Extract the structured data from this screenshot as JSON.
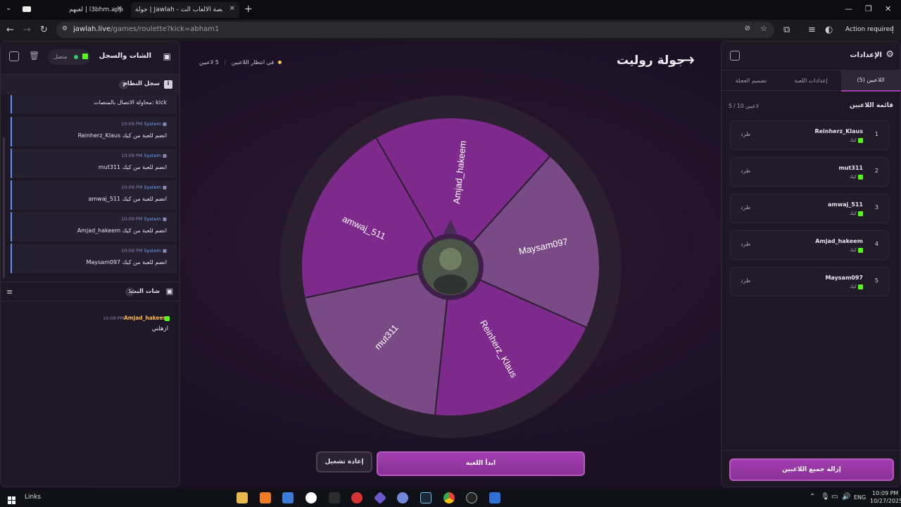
{
  "browser": {
    "tabs": [
      {
        "label": "لعبهم | l3bhm.app"
      },
      {
        "label": "جولة | Jawlah - منصة الألعاب الت..."
      }
    ],
    "url_host": "jawlah.live",
    "url_path": "/games/roulette?kick=abham1",
    "action_required": "Action required"
  },
  "left": {
    "title": "الشات والسجل",
    "status": "متصل",
    "system_log_title": "سجل النظام",
    "system_log_count": "7",
    "first_log_text": "محاولة الاتصال بالمنصات: kick",
    "logs": [
      {
        "time": "10:09 PM",
        "source": "System",
        "text": "Reinherz_Klaus انضم للعبة من كيك"
      },
      {
        "time": "10:09 PM",
        "source": "System",
        "text": "mut311 انضم للعبة من كيك"
      },
      {
        "time": "10:09 PM",
        "source": "System",
        "text": "amwaj_511 انضم للعبة من كيك"
      },
      {
        "time": "10:09 PM",
        "source": "System",
        "text": "Amjad_hakeem انضم للعبة من كيك"
      },
      {
        "time": "10:09 PM",
        "source": "System",
        "text": "Maysam097 انضم للعبة من كيك"
      }
    ],
    "live_chat_title": "شات البث",
    "live_chat_count": "1",
    "chat": [
      {
        "user": "Amjad_hakeem",
        "time": "10:09 PM",
        "text": "ازهلني"
      }
    ]
  },
  "center": {
    "title": "جولة روليت",
    "players_count": "5 لاعبين",
    "status": "في انتظار اللاعبين",
    "wheel_segments": [
      "Amjad_hakeem",
      "Maysam097",
      "Reinherz_Klaus",
      "mut311",
      "amwaj_511"
    ],
    "start_button": "ابدأ اللعبة",
    "restart_button": "إعادة تشغيل"
  },
  "right": {
    "title": "الإعدادات",
    "tabs": [
      "اللاعبين (5)",
      "إعدادات اللعبة",
      "تصميم العجلة"
    ],
    "list_title": "قائمة اللاعبين",
    "capacity": "5 / 10 لاعبين",
    "players": [
      {
        "num": "1",
        "name": "Reinherz_Klaus",
        "platform": "كيك",
        "kick": "طرد"
      },
      {
        "num": "2",
        "name": "mut311",
        "platform": "كيك",
        "kick": "طرد"
      },
      {
        "num": "3",
        "name": "amwaj_511",
        "platform": "كيك",
        "kick": "طرد"
      },
      {
        "num": "4",
        "name": "Amjad_hakeem",
        "platform": "كيك",
        "kick": "طرد"
      },
      {
        "num": "5",
        "name": "Maysam097",
        "platform": "كيك",
        "kick": "طرد"
      }
    ],
    "remove_all": "إزالة جميع اللاعبين"
  },
  "taskbar": {
    "links": "Links",
    "lang": "ENG",
    "time": "10:09 PM",
    "date": "10/27/2025"
  },
  "colors": {
    "wheel_dark": "#7d2a8c",
    "wheel_light": "#7a4a86",
    "accent": "#a23fb0",
    "kick_green": "#53fc18"
  }
}
